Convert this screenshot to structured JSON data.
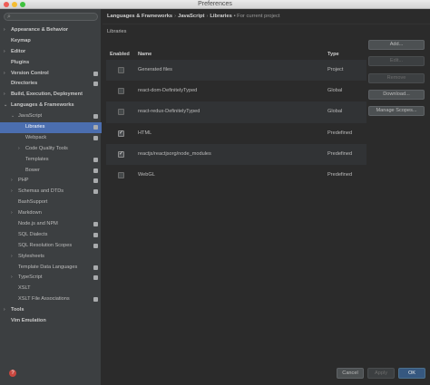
{
  "window": {
    "title": "Preferences"
  },
  "sidebar": {
    "search_placeholder": "",
    "items": [
      {
        "label": "Appearance & Behavior",
        "level": 0,
        "arrow": "›",
        "bold": true,
        "proj": false,
        "selected": false
      },
      {
        "label": "Keymap",
        "level": 0,
        "arrow": "",
        "bold": true,
        "proj": false,
        "selected": false
      },
      {
        "label": "Editor",
        "level": 0,
        "arrow": "›",
        "bold": true,
        "proj": false,
        "selected": false
      },
      {
        "label": "Plugins",
        "level": 0,
        "arrow": "",
        "bold": true,
        "proj": false,
        "selected": false
      },
      {
        "label": "Version Control",
        "level": 0,
        "arrow": "›",
        "bold": true,
        "proj": true,
        "selected": false
      },
      {
        "label": "Directories",
        "level": 0,
        "arrow": "",
        "bold": true,
        "proj": true,
        "selected": false
      },
      {
        "label": "Build, Execution, Deployment",
        "level": 0,
        "arrow": "›",
        "bold": true,
        "proj": false,
        "selected": false
      },
      {
        "label": "Languages & Frameworks",
        "level": 0,
        "arrow": "⌄",
        "bold": true,
        "proj": false,
        "selected": false
      },
      {
        "label": "JavaScript",
        "level": 1,
        "arrow": "⌄",
        "bold": false,
        "proj": true,
        "selected": false
      },
      {
        "label": "Libraries",
        "level": 2,
        "arrow": "",
        "bold": false,
        "proj": true,
        "selected": true
      },
      {
        "label": "Webpack",
        "level": 2,
        "arrow": "",
        "bold": false,
        "proj": true,
        "selected": false
      },
      {
        "label": "Code Quality Tools",
        "level": 2,
        "arrow": "›",
        "bold": false,
        "proj": false,
        "selected": false
      },
      {
        "label": "Templates",
        "level": 2,
        "arrow": "",
        "bold": false,
        "proj": true,
        "selected": false
      },
      {
        "label": "Bower",
        "level": 2,
        "arrow": "",
        "bold": false,
        "proj": true,
        "selected": false
      },
      {
        "label": "PHP",
        "level": 1,
        "arrow": "›",
        "bold": false,
        "proj": true,
        "selected": false
      },
      {
        "label": "Schemas and DTDs",
        "level": 1,
        "arrow": "›",
        "bold": false,
        "proj": true,
        "selected": false
      },
      {
        "label": "BashSupport",
        "level": 1,
        "arrow": "",
        "bold": false,
        "proj": false,
        "selected": false
      },
      {
        "label": "Markdown",
        "level": 1,
        "arrow": "›",
        "bold": false,
        "proj": false,
        "selected": false
      },
      {
        "label": "Node.js and NPM",
        "level": 1,
        "arrow": "",
        "bold": false,
        "proj": true,
        "selected": false
      },
      {
        "label": "SQL Dialects",
        "level": 1,
        "arrow": "",
        "bold": false,
        "proj": true,
        "selected": false
      },
      {
        "label": "SQL Resolution Scopes",
        "level": 1,
        "arrow": "",
        "bold": false,
        "proj": true,
        "selected": false
      },
      {
        "label": "Stylesheets",
        "level": 1,
        "arrow": "›",
        "bold": false,
        "proj": false,
        "selected": false
      },
      {
        "label": "Template Data Languages",
        "level": 1,
        "arrow": "",
        "bold": false,
        "proj": true,
        "selected": false
      },
      {
        "label": "TypeScript",
        "level": 1,
        "arrow": "›",
        "bold": false,
        "proj": true,
        "selected": false
      },
      {
        "label": "XSLT",
        "level": 1,
        "arrow": "",
        "bold": false,
        "proj": false,
        "selected": false
      },
      {
        "label": "XSLT File Associations",
        "level": 1,
        "arrow": "",
        "bold": false,
        "proj": true,
        "selected": false
      },
      {
        "label": "Tools",
        "level": 0,
        "arrow": "›",
        "bold": true,
        "proj": false,
        "selected": false
      },
      {
        "label": "Vim Emulation",
        "level": 0,
        "arrow": "",
        "bold": true,
        "proj": false,
        "selected": false
      }
    ],
    "help_icon": "?"
  },
  "breadcrumb": {
    "part1": "Languages & Frameworks",
    "sep": "›",
    "part2": "JavaScript",
    "part3": "Libraries",
    "current": "For current project"
  },
  "section_title": "Libraries",
  "table": {
    "headers": {
      "enabled": "Enabled",
      "name": "Name",
      "type": "Type"
    },
    "rows": [
      {
        "enabled": false,
        "name": "Generated files",
        "type": "Project"
      },
      {
        "enabled": false,
        "name": "react-dom-DefinitelyTyped",
        "type": "Global"
      },
      {
        "enabled": false,
        "name": "react-redux-DefinitelyTyped",
        "type": "Global"
      },
      {
        "enabled": true,
        "name": "HTML",
        "type": "Predefined"
      },
      {
        "enabled": true,
        "name": "reactjs/reactjsorg/node_modules",
        "type": "Predefined"
      },
      {
        "enabled": false,
        "name": "WebGL",
        "type": "Predefined"
      }
    ]
  },
  "buttons": {
    "add": "Add...",
    "edit": "Edit...",
    "remove": "Remove",
    "download": "Download...",
    "manage_scopes": "Manage Scopes..."
  },
  "footer": {
    "cancel": "Cancel",
    "apply": "Apply",
    "ok": "OK"
  },
  "colors": {
    "selection": "#4b6eaf",
    "background": "#2b2b2b",
    "sidebar": "#3c3f41",
    "ok_button": "#365880"
  }
}
